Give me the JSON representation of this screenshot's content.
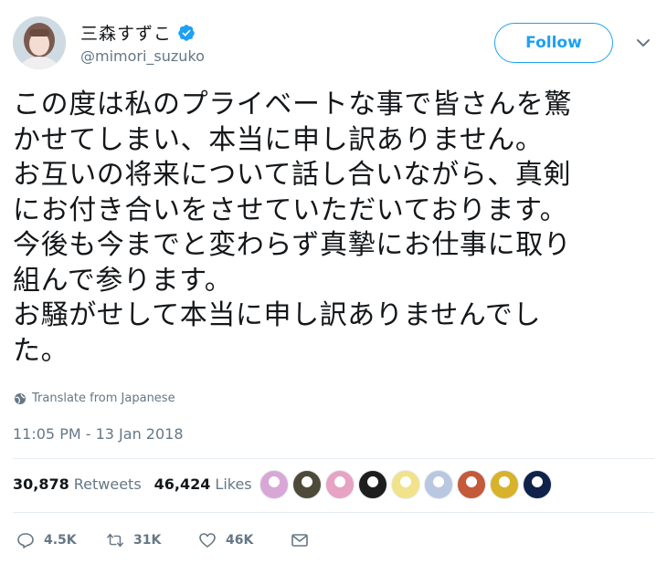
{
  "user": {
    "display_name": "三森すずこ",
    "handle": "@mimori_suzuko",
    "verified": true
  },
  "follow_label": "Follow",
  "tweet_lines": [
    "この度は私のプライベートな事で皆さんを驚",
    "かせてしまい、本当に申し訳ありません。",
    "お互いの将来について話し合いながら、真剣",
    "にお付き合いをさせていただいております。",
    "今後も今までと変わらず真摯にお仕事に取り",
    "組んで参ります。",
    "お騒がせして本当に申し訳ありませんでし",
    "た。"
  ],
  "translate_label": "Translate from Japanese",
  "timestamp": "11:05 PM - 13 Jan 2018",
  "stats": {
    "retweets_count": "30,878",
    "retweets_label": "Retweets",
    "likes_count": "46,424",
    "likes_label": "Likes"
  },
  "liker_avatars": [
    {
      "icon": "avatar-1",
      "color": "#d9a7d6"
    },
    {
      "icon": "avatar-2",
      "color": "#4d4a3a"
    },
    {
      "icon": "avatar-3",
      "color": "#e7a2c4"
    },
    {
      "icon": "avatar-4",
      "color": "#1e1e1e"
    },
    {
      "icon": "avatar-5",
      "color": "#f2e28a"
    },
    {
      "icon": "avatar-6",
      "color": "#b9c7e0"
    },
    {
      "icon": "avatar-7",
      "color": "#c45a3a"
    },
    {
      "icon": "avatar-8",
      "color": "#d8b22a"
    },
    {
      "icon": "avatar-9",
      "color": "#10224a"
    }
  ],
  "actions": {
    "reply_count": "4.5K",
    "retweet_count": "31K",
    "like_count": "46K"
  },
  "colors": {
    "accent": "#1da1f2",
    "text": "#14171a",
    "muted": "#657786",
    "divider": "#e6ecf0"
  }
}
